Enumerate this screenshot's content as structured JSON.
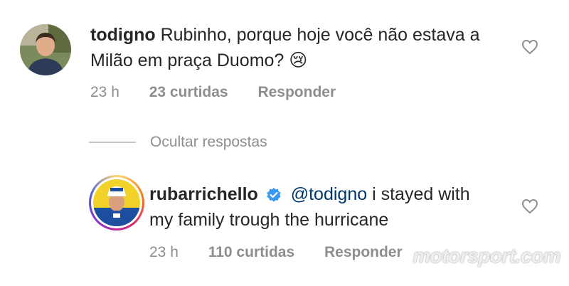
{
  "comment": {
    "username": "todigno",
    "text": "Rubinho, porque hoje você não estava a Milão em praça Duomo?",
    "emoji": "😢",
    "time": "23 h",
    "likes": "23 curtidas",
    "reply_label": "Responder"
  },
  "replies_toggle": {
    "label": "Ocultar respostas"
  },
  "reply": {
    "username": "rubarrichello",
    "mention": "@todigno",
    "text": "i stayed with my family trough the hurricane",
    "time": "23 h",
    "likes": "110 curtidas",
    "reply_label": "Responder"
  },
  "watermark": "motorsport.com",
  "colors": {
    "text": "#262626",
    "secondary": "#8e8e8e",
    "mention": "#00376b",
    "verified": "#3897f0"
  }
}
